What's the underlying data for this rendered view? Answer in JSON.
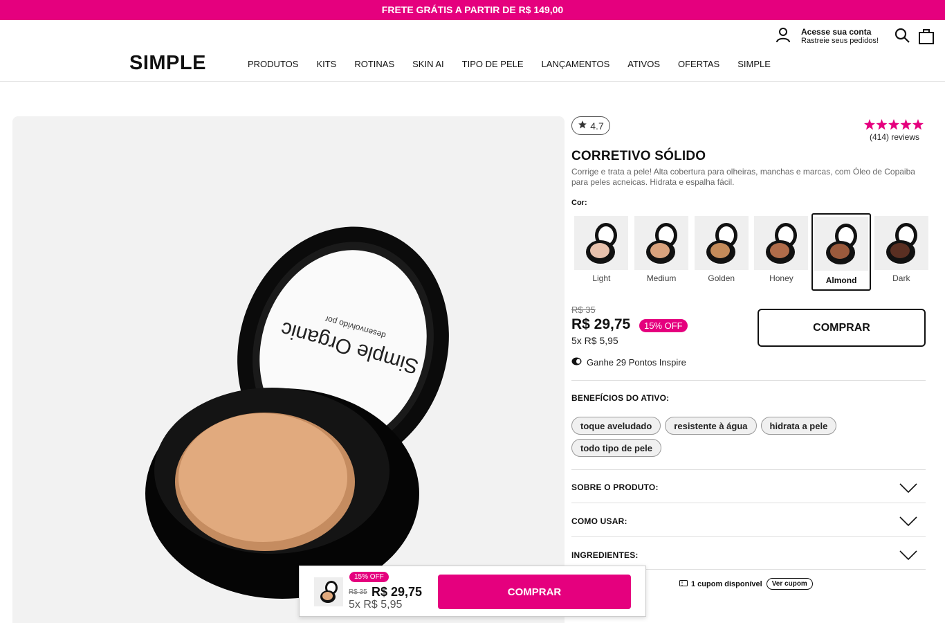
{
  "announcement": "FRETE GRÁTIS A PARTIR DE R$ 149,00",
  "header": {
    "logo": "SIMPLE",
    "nav": [
      "PRODUTOS",
      "KITS",
      "ROTINAS",
      "SKIN AI",
      "TIPO DE PELE",
      "LANÇAMENTOS",
      "ATIVOS",
      "OFERTAS",
      "SIMPLE"
    ],
    "account_title": "Acesse sua conta",
    "account_subtitle": "Rastreie seus pedidos!",
    "icons": [
      "user-icon",
      "search-icon",
      "bag-icon"
    ]
  },
  "gallery": {
    "lid_text_1": "Simple Organic",
    "lid_text_2": "desenvolvido por"
  },
  "product": {
    "rating": "4.7",
    "stars": 5,
    "reviews": "(414) reviews",
    "title": "CORRETIVO SÓLIDO",
    "description": "Corrige e trata a pele! Alta cobertura para olheiras, manchas e marcas, com Óleo de Copaiba para peles acneicas. Hidrata e espalha fácil.",
    "color_label": "Cor:",
    "shades": [
      {
        "name": "Light",
        "color": "#e8c2ad",
        "selected": false
      },
      {
        "name": "Medium",
        "color": "#d9a27d",
        "selected": false
      },
      {
        "name": "Golden",
        "color": "#c48b5a",
        "selected": false
      },
      {
        "name": "Honey",
        "color": "#b06c4a",
        "selected": false
      },
      {
        "name": "Almond",
        "color": "#9b5a3c",
        "selected": true
      },
      {
        "name": "Dark",
        "color": "#5a2f22",
        "selected": false
      }
    ],
    "old_price": "R$ 35",
    "price": "R$ 29,75",
    "discount": "15% OFF",
    "installments": "5x R$ 5,95",
    "buy_label": "COMPRAR",
    "points": "Ganhe 29 Pontos Inspire",
    "benefits_title": "BENEFÍCIOS DO ATIVO:",
    "benefits": [
      "toque aveludado",
      "resistente à água",
      "hidrata a pele",
      "todo tipo de pele"
    ],
    "accordions": [
      "SOBRE O PRODUTO:",
      "COMO USAR:",
      "INGREDIENTES:"
    ],
    "coupon_text": "1 cupom disponível",
    "coupon_button": "Ver cupom"
  },
  "sticky": {
    "discount": "15% OFF",
    "old_price": "R$ 35",
    "price": "R$ 29,75",
    "installments": "5x R$ 5,95",
    "buy_label": "COMPRAR"
  },
  "colors": {
    "brand_pink": "#e5007e"
  }
}
